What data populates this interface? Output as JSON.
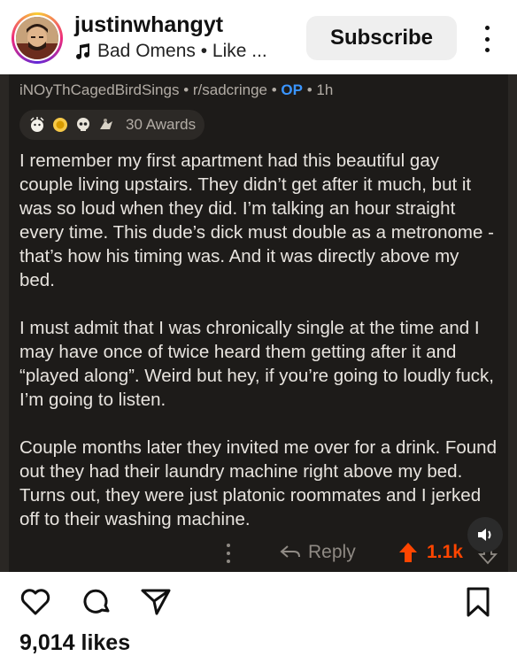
{
  "header": {
    "username": "justinwhangyt",
    "audio_label": "Bad Omens • Like ...",
    "subscribe_label": "Subscribe"
  },
  "post": {
    "author": "iNOyThCagedBirdSings",
    "separator1": "•",
    "subreddit": "r/sadcringe",
    "separator2": "•",
    "op_badge": "OP",
    "separator3": "•",
    "time": "1h",
    "awards_count": "30 Awards",
    "paragraphs": [
      "I remember my first apartment had this beautiful gay couple living upstairs. They didn’t get after it much, but it was so loud when they did. I’m talking an hour straight every time. This dude’s dick must double as a metronome - that’s how his timing was. And it was directly above my bed.",
      "I must admit that I was chronically single at the time and I may have once of twice heard them getting after it and “played along”. Weird but hey, if you’re going to loudly fuck, I’m going to listen.",
      "Couple months later they invited me over for a drink. Found out they had their laundry machine right above my bed. Turns out, they were just platonic roommates and I jerked off to their washing machine."
    ],
    "reply_label": "Reply",
    "vote_count": "1.1k"
  },
  "footer": {
    "likes": "9,014 likes"
  },
  "colors": {
    "op": "#3a95ff",
    "upvote": "#ff4500",
    "card_bg": "#1d1b19"
  }
}
